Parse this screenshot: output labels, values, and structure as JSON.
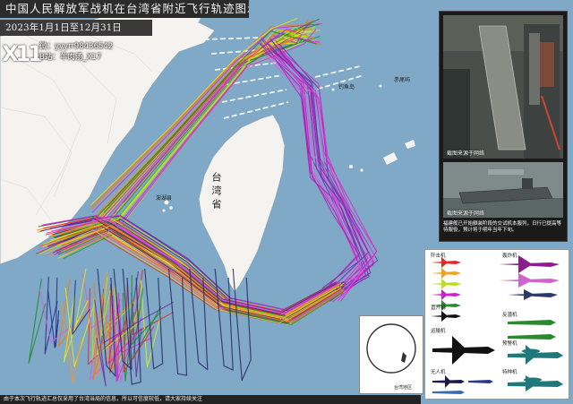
{
  "title": "中国人民解放军战机在台湾省附近飞行轨迹图示",
  "date_range": "2023年1月1日至12月31日",
  "logo_text": "X11",
  "authors": {
    "weibo": "微：yyyrr98436542",
    "bilibili": "B站：羊肉汤_X17"
  },
  "map_labels": {
    "taiwan": "台湾省",
    "diaoyu": "钓鱼岛",
    "chiwei": "赤尾屿",
    "penghu": "澎湖县"
  },
  "photo_captions": {
    "photo1": "截图来源于网络",
    "photo2": "截图来源于网络",
    "photo3": "福建舰已开始舾装阶段的交试机本服列，日行已提高等待服役，预计将于明年当年下旬。"
  },
  "legend_categories": {
    "fighter": "歼击机",
    "bomber": "轰炸机",
    "transport": "运输机",
    "uav": "无人机",
    "early_warning": "预警机",
    "patrol": "反潜机",
    "special": "特种机",
    "helicopter": "直升机"
  },
  "inset_label": "台湾地区",
  "bottom_note": "由于本次飞行轨迹汇总仅采用了台湾当局的信息，所以可信度较低，请大家持续关注",
  "colors": {
    "sea": "#7fa9c6",
    "land": "#f4f3ef",
    "accent_magenta": "#e020d0",
    "accent_purple": "#6a2ea8",
    "accent_green": "#1f8a2a",
    "accent_orange": "#f07a1a",
    "accent_yellow": "#e8e815"
  },
  "icons": [
    "fighter-silhouette-icon",
    "bomber-silhouette-icon",
    "transport-silhouette-icon",
    "awacs-silhouette-icon",
    "uav-silhouette-icon",
    "globe-icon"
  ]
}
